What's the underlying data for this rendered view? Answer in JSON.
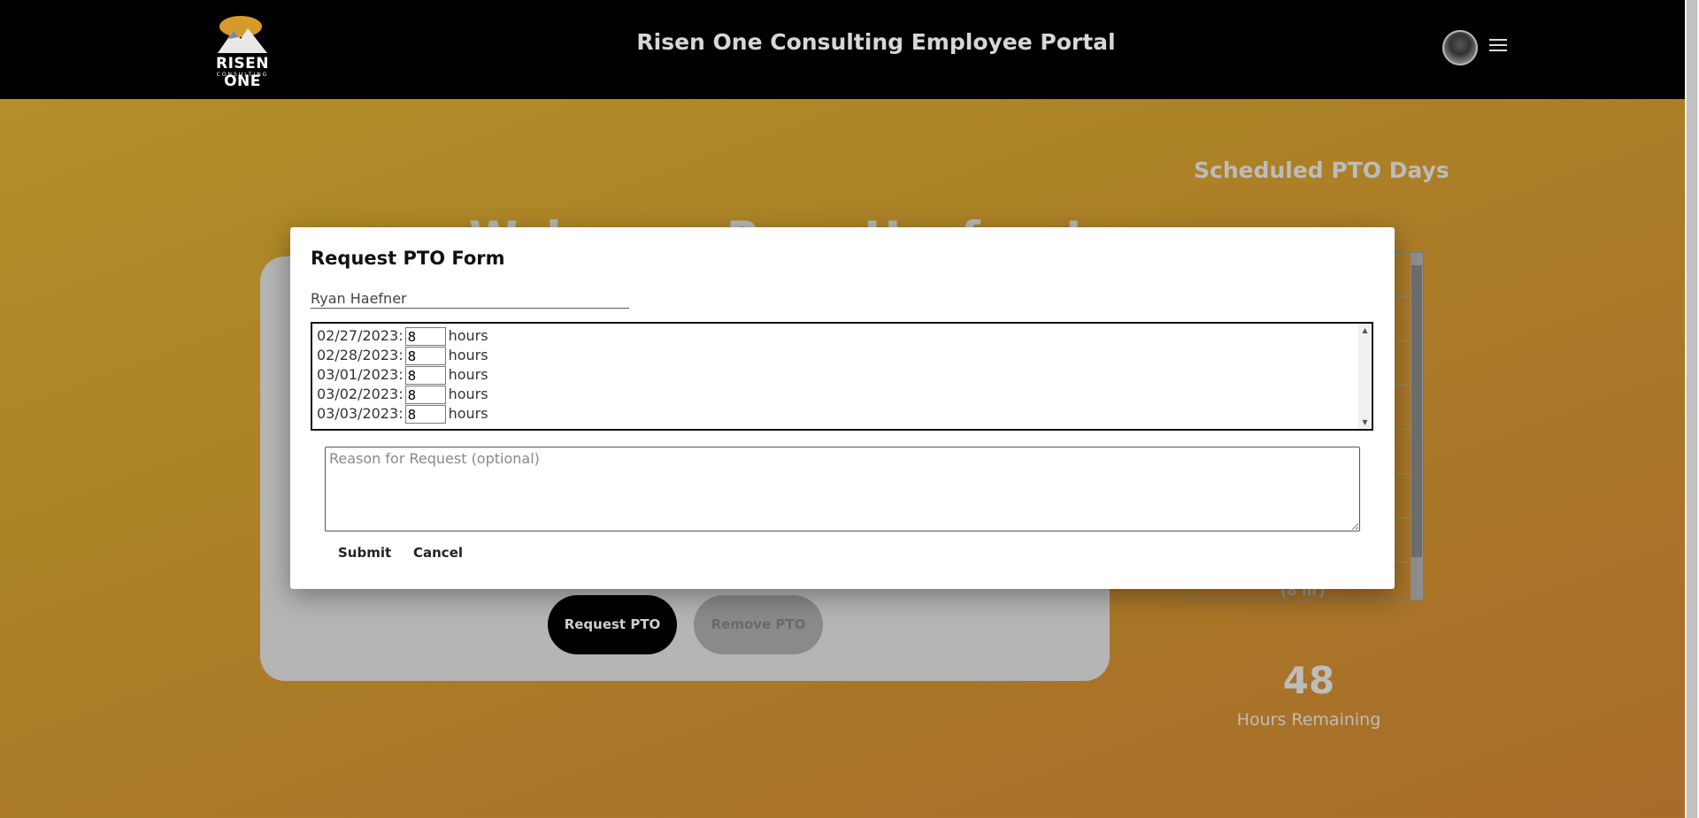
{
  "header": {
    "logo_text": "RISEN ONE",
    "logo_sub": "CONSULTING",
    "title": "Risen One Consulting Employee Portal"
  },
  "background": {
    "welcome_text": "Welcome, Ryan Haefner!",
    "request_pto_label": "Request PTO",
    "remove_pto_label": "Remove PTO",
    "scheduled_title": "Scheduled PTO Days",
    "scheduled_partial": "(8 hr)",
    "hours_remaining_value": "48",
    "hours_remaining_label": "Hours Remaining"
  },
  "modal": {
    "title": "Request PTO Form",
    "employee_name": "Ryan Haefner",
    "hours_unit": "hours",
    "dates": [
      {
        "date": "02/27/2023:",
        "hours": "8"
      },
      {
        "date": "02/28/2023:",
        "hours": "8"
      },
      {
        "date": "03/01/2023:",
        "hours": "8"
      },
      {
        "date": "03/02/2023:",
        "hours": "8"
      },
      {
        "date": "03/03/2023:",
        "hours": "8"
      }
    ],
    "reason_placeholder": "Reason for Request (optional)",
    "submit_label": "Submit",
    "cancel_label": "Cancel"
  },
  "colors": {
    "topbar": "#000000",
    "background_gold": "#ad8427",
    "modal": "#ffffff"
  }
}
